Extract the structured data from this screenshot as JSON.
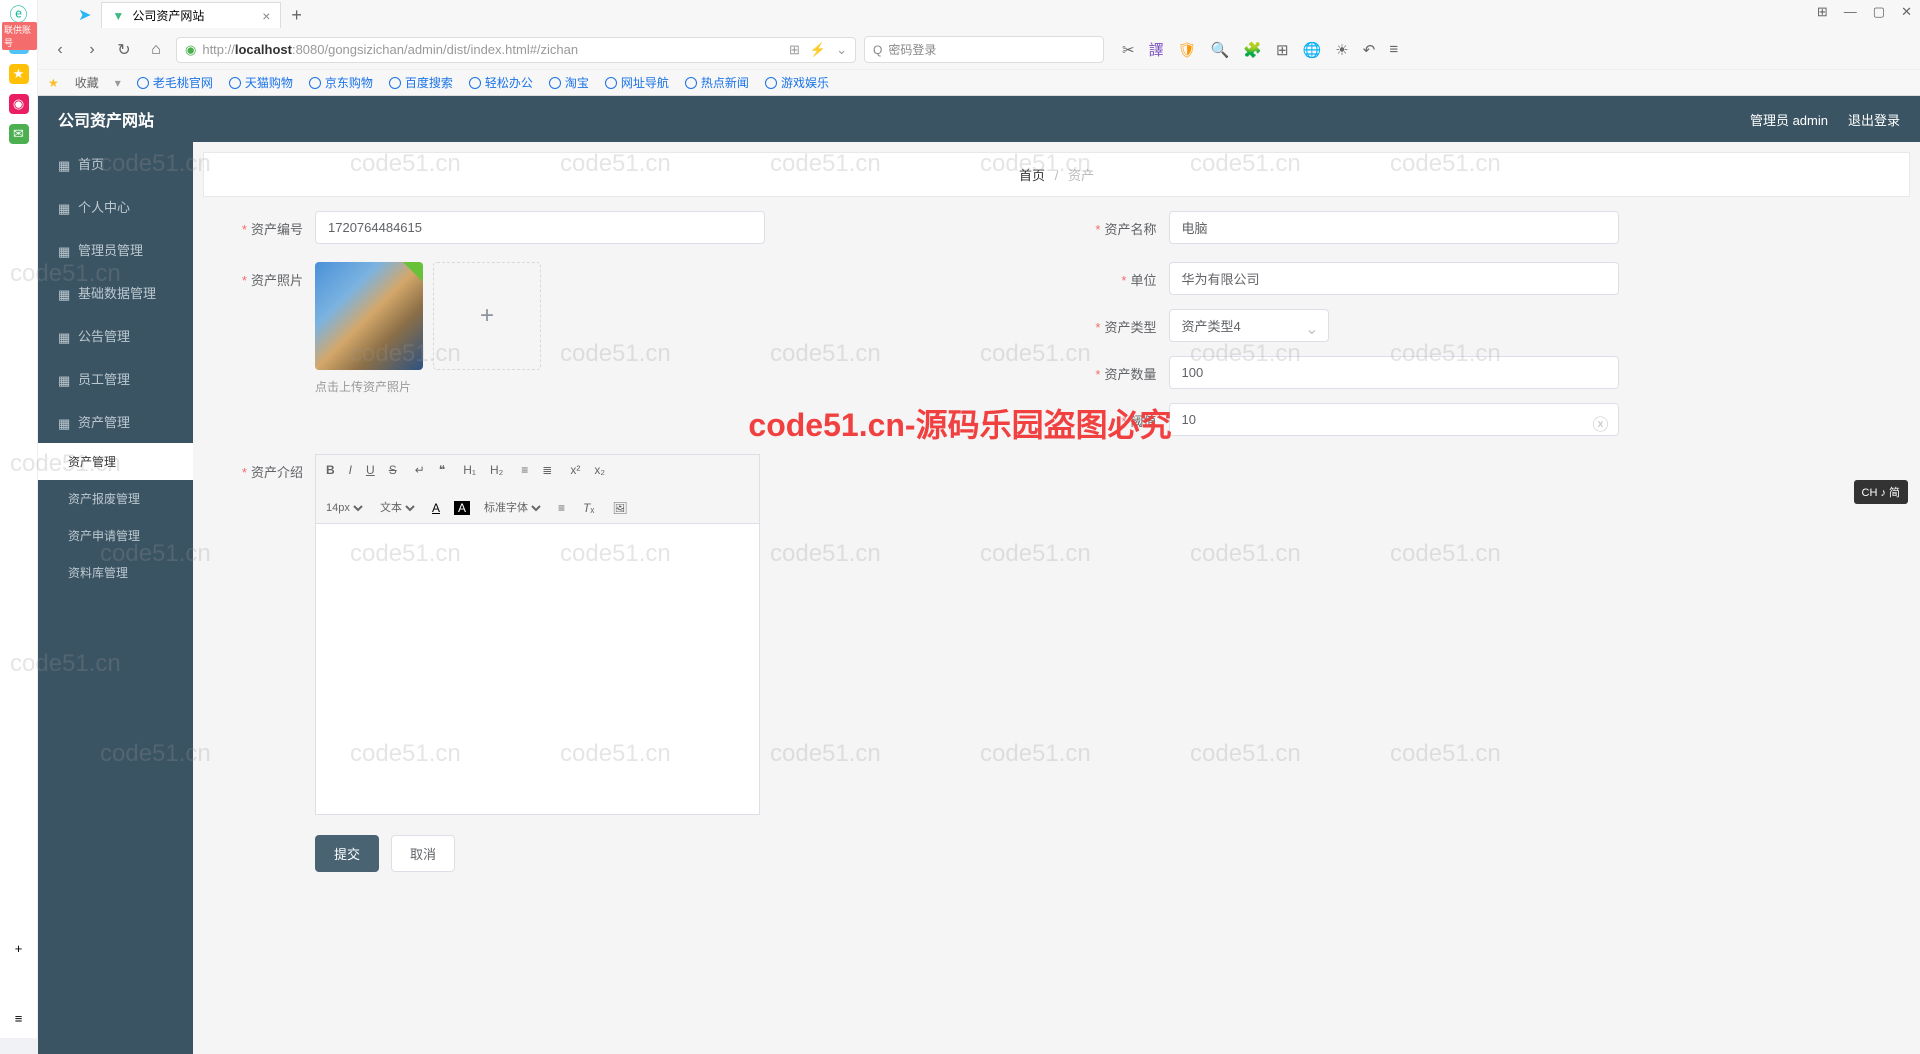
{
  "browser": {
    "tab_title": "公司资产网站",
    "url_prefix": "http://",
    "url_host": "localhost",
    "url_path": ":8080/gongsizichan/admin/dist/index.html#/zichan",
    "search_placeholder": "密码登录",
    "bookmarks": [
      "老毛桃官网",
      "天猫购物",
      "京东购物",
      "百度搜索",
      "轻松办公",
      "淘宝",
      "网址导航",
      "热点新闻",
      "游戏娱乐"
    ],
    "fav_label": "收藏"
  },
  "leftRail": {
    "badge": "联供账号"
  },
  "header": {
    "title": "公司资产网站",
    "user": "管理员 admin",
    "logout": "退出登录"
  },
  "sidebar": {
    "items": [
      {
        "label": "首页"
      },
      {
        "label": "个人中心"
      },
      {
        "label": "管理员管理"
      },
      {
        "label": "基础数据管理"
      },
      {
        "label": "公告管理"
      },
      {
        "label": "员工管理"
      },
      {
        "label": "资产管理",
        "children": [
          {
            "label": "资产管理",
            "active": true
          },
          {
            "label": "资产报废管理"
          },
          {
            "label": "资产申请管理"
          },
          {
            "label": "资料库管理"
          }
        ]
      }
    ]
  },
  "breadcrumb": {
    "home": "首页",
    "current": "资产"
  },
  "form": {
    "asset_no_label": "资产编号",
    "asset_no_value": "1720764484615",
    "asset_name_label": "资产名称",
    "asset_name_value": "电脑",
    "unit_label": "单位",
    "unit_value": "华为有限公司",
    "photo_label": "资产照片",
    "photo_hint": "点击上传资产照片",
    "type_label": "资产类型",
    "type_value": "资产类型4",
    "qty_label": "资产数量",
    "qty_value": "100",
    "threshold_label": "阈值",
    "threshold_value": "10",
    "intro_label": "资产介绍",
    "editor": {
      "font_size": "14px",
      "font_type": "文本",
      "font_family": "标准字体"
    },
    "submit": "提交",
    "cancel": "取消"
  },
  "watermark": {
    "red": "code51.cn-源码乐园盗图必究",
    "gray": "code51.cn"
  },
  "ime": "CH ♪ 简"
}
